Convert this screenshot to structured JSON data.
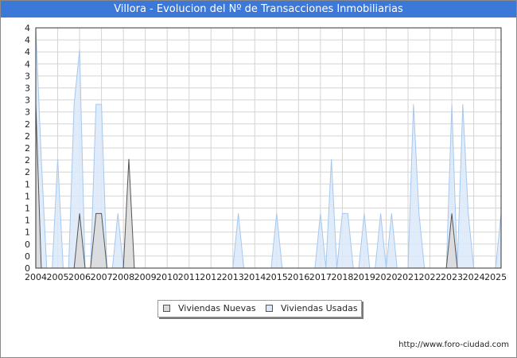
{
  "title": "Villora - Evolucion del Nº de Transacciones Inmobiliarias",
  "footer": {
    "url": "http://www.foro-ciudad.com"
  },
  "legend": {
    "nuevas_label": "Viviendas Nuevas",
    "usadas_label": "Viviendas Usadas"
  },
  "colors": {
    "title_bg": "#3c78d8",
    "usadas_fill": "#dce9f9",
    "usadas_line": "#a6c8ef",
    "nuevas_fill": "#d9d9d9",
    "nuevas_line": "#555555",
    "grid": "#d4d4d4"
  },
  "chart_data": {
    "type": "area",
    "title": "Villora - Evolucion del Nº de Transacciones Inmobiliarias",
    "x_tick_labels": [
      "2004",
      "2005",
      "2006",
      "2007",
      "2008",
      "2009",
      "2010",
      "2011",
      "2012",
      "2013",
      "2014",
      "2015",
      "2016",
      "2017",
      "2018",
      "2019",
      "2020",
      "2021",
      "2022",
      "2023",
      "2024",
      "2025"
    ],
    "y_tick_labels": [
      "0",
      "0",
      "0",
      "1",
      "1",
      "1",
      "1",
      "1",
      "2",
      "2",
      "2",
      "2",
      "2",
      "3",
      "3",
      "3",
      "3",
      "4",
      "4",
      "4",
      "4"
    ],
    "ylim": [
      0,
      4.4
    ],
    "x_range": [
      2004,
      2025.25
    ],
    "grid": true,
    "legend_position": "bottom-center",
    "series": [
      {
        "name": "Viviendas Usadas",
        "points": [
          [
            2004.0,
            4.4
          ],
          [
            2004.25,
            2
          ],
          [
            2004.5,
            0
          ],
          [
            2004.75,
            0
          ],
          [
            2005.0,
            2
          ],
          [
            2005.25,
            0
          ],
          [
            2005.5,
            0
          ],
          [
            2005.75,
            3
          ],
          [
            2006.0,
            4
          ],
          [
            2006.25,
            0
          ],
          [
            2006.5,
            0
          ],
          [
            2006.75,
            3
          ],
          [
            2007.0,
            3
          ],
          [
            2007.25,
            0
          ],
          [
            2007.5,
            0
          ],
          [
            2007.75,
            1
          ],
          [
            2008.0,
            0
          ],
          [
            2008.25,
            0
          ],
          [
            2013.0,
            0
          ],
          [
            2013.25,
            1
          ],
          [
            2013.5,
            0
          ],
          [
            2014.75,
            0
          ],
          [
            2015.0,
            1
          ],
          [
            2015.25,
            0
          ],
          [
            2016.75,
            0
          ],
          [
            2017.0,
            1
          ],
          [
            2017.25,
            0
          ],
          [
            2017.5,
            2
          ],
          [
            2017.75,
            0
          ],
          [
            2018.0,
            1
          ],
          [
            2018.25,
            1
          ],
          [
            2018.5,
            0
          ],
          [
            2018.75,
            0
          ],
          [
            2019.0,
            1
          ],
          [
            2019.25,
            0
          ],
          [
            2019.5,
            0
          ],
          [
            2019.75,
            1
          ],
          [
            2020.0,
            0
          ],
          [
            2020.25,
            1
          ],
          [
            2020.5,
            0
          ],
          [
            2020.75,
            0
          ],
          [
            2021.0,
            0
          ],
          [
            2021.25,
            3
          ],
          [
            2021.5,
            1
          ],
          [
            2021.75,
            0
          ],
          [
            2022.5,
            0
          ],
          [
            2022.75,
            0
          ],
          [
            2023.0,
            3
          ],
          [
            2023.25,
            0
          ],
          [
            2023.5,
            3
          ],
          [
            2023.75,
            1
          ],
          [
            2024.0,
            0
          ],
          [
            2024.75,
            0
          ],
          [
            2025.0,
            0
          ],
          [
            2025.25,
            1
          ]
        ]
      },
      {
        "name": "Viviendas Nuevas",
        "points": [
          [
            2004.0,
            3
          ],
          [
            2004.25,
            0
          ],
          [
            2005.75,
            0
          ],
          [
            2006.0,
            1
          ],
          [
            2006.25,
            0
          ],
          [
            2006.5,
            0
          ],
          [
            2006.75,
            1
          ],
          [
            2007.0,
            1
          ],
          [
            2007.25,
            0
          ],
          [
            2008.0,
            0
          ],
          [
            2008.25,
            2
          ],
          [
            2008.5,
            0
          ],
          [
            2022.75,
            0
          ],
          [
            2023.0,
            1
          ],
          [
            2023.25,
            0
          ],
          [
            2025.25,
            0
          ]
        ]
      }
    ]
  }
}
